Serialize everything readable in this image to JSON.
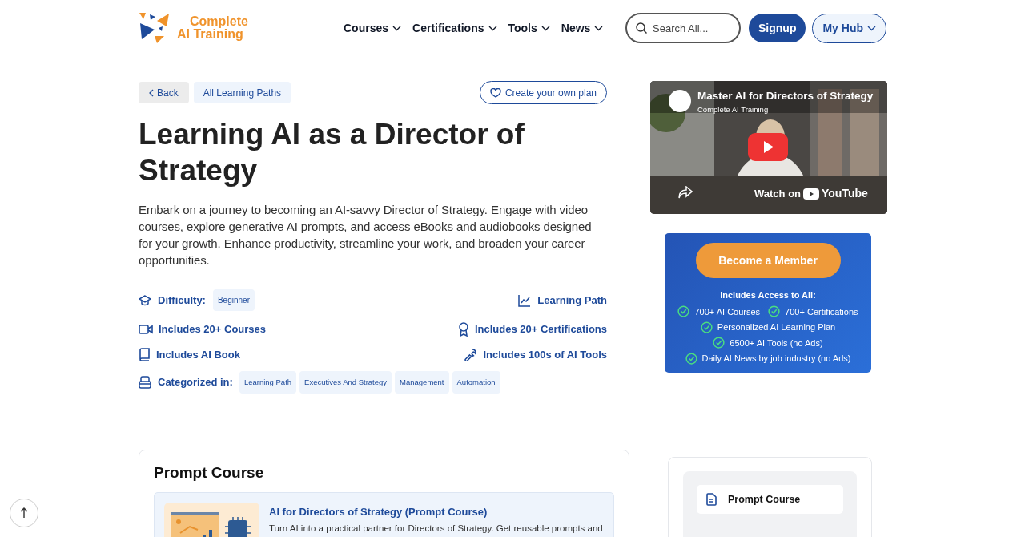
{
  "logo": {
    "line_1": "Complete",
    "line_2": "AI Training"
  },
  "nav": [
    {
      "label": "Courses"
    },
    {
      "label": "Certifications"
    },
    {
      "label": "Tools"
    },
    {
      "label": "News"
    }
  ],
  "search": {
    "placeholder": "Search All..."
  },
  "signup": "Signup",
  "hub": "My Hub",
  "back": "Back",
  "all_paths": "All Learning Paths",
  "create_plan": "Create your own plan",
  "title": "Learning AI as a Director of Strategy",
  "intro": "Embark on a journey to becoming an AI-savvy Director of Strategy. Engage with video courses, explore generative AI prompts, and access eBooks and audiobooks designed for your growth. Enhance productivity, streamline your work, and broaden your career opportunities.",
  "difficulty": {
    "label": "Difficulty:",
    "value": "Beginner"
  },
  "type_label": "Learning Path",
  "features": [
    {
      "kind": "video",
      "text": "Includes 20+ Courses"
    },
    {
      "kind": "award",
      "text": "Includes 20+ Certifications"
    },
    {
      "kind": "book",
      "text": "Includes AI Book"
    },
    {
      "kind": "wrench",
      "text": "Includes 100s of AI Tools"
    }
  ],
  "categories": {
    "label": "Categorized in:",
    "tags": [
      "Learning Path",
      "Executives And Strategy",
      "Management",
      "Automation"
    ]
  },
  "video": {
    "title": "Master AI for Directors of Strategy",
    "channel": "Complete AI Training",
    "watch": "Watch on",
    "brand": "YouTube"
  },
  "member": {
    "button": "Become a Member",
    "heading": "Includes Access to All:",
    "lines": [
      [
        "700+ AI Courses",
        "700+ Certifications"
      ],
      [
        "Personalized AI Learning Plan"
      ],
      [
        "6500+ AI Tools (no Ads)"
      ],
      [
        "Daily AI News by job industry (no Ads)"
      ]
    ]
  },
  "prompt_section": {
    "heading": "Prompt Course",
    "card_title": "AI for Directors of Strategy (Prompt Course)",
    "card_text": "Turn AI into a practical partner for Directors of Strategy. Get reusable prompts and"
  },
  "side_menu": [
    {
      "kind": "doc",
      "label": "Prompt Course"
    }
  ]
}
